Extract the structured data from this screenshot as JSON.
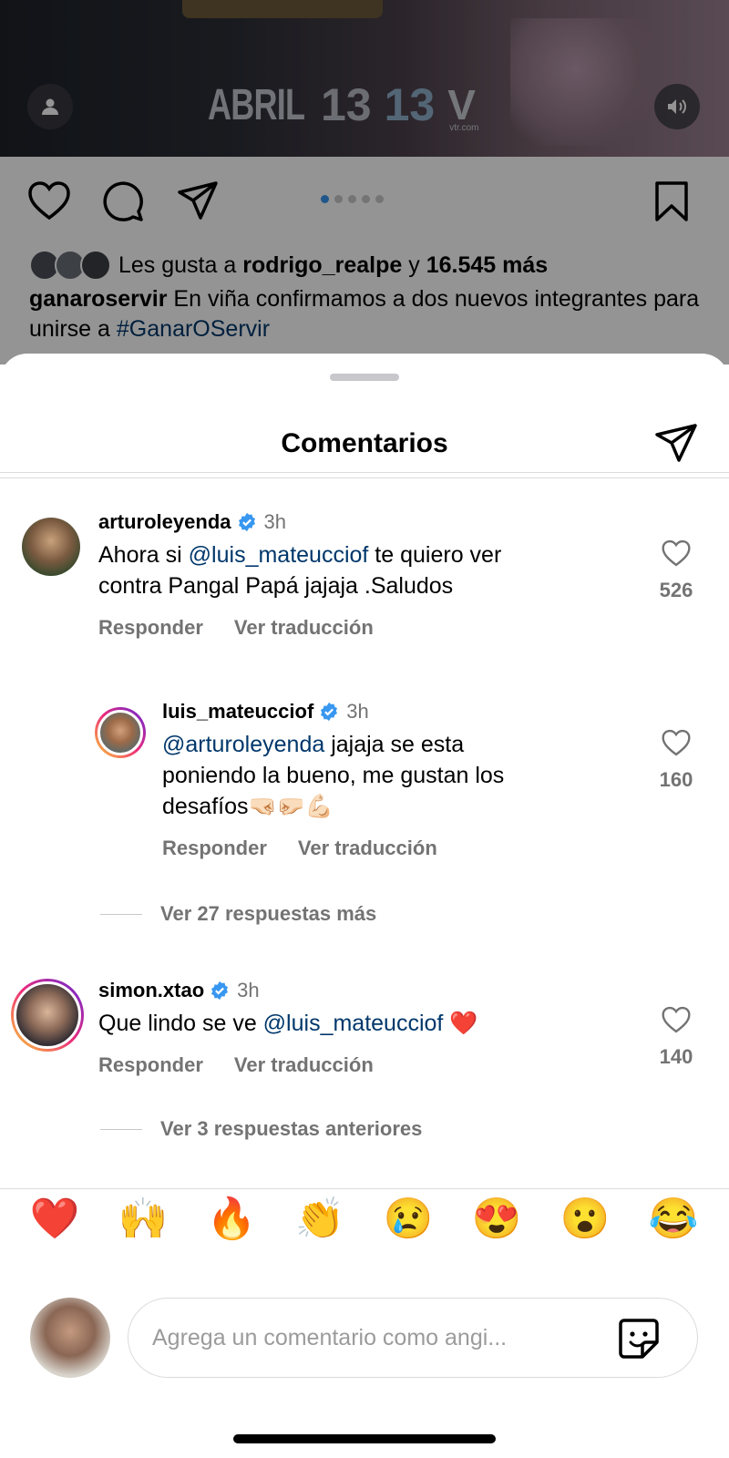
{
  "post": {
    "media_brand": {
      "abril": "ABRIL",
      "n13a": "13",
      "n13b": "13",
      "vtr": "V",
      "vtr_small": "vtr.com"
    },
    "carousel_pages": 5,
    "carousel_active": 1,
    "likes": {
      "prefix": "Les gusta a",
      "user": "rodrigo_realpe",
      "joiner": "y",
      "count": "16.545 más"
    },
    "caption": {
      "user": "ganaroservir",
      "text": "En viña confirmamos a dos nuevos integrantes para unirse a",
      "hashtag": "#GanarOServir"
    }
  },
  "sheet": {
    "title": "Comentarios"
  },
  "comments": [
    {
      "username": "arturoleyenda",
      "time": "3h",
      "mention": "",
      "text_line1_prefix": "Ahora si ",
      "text_line1_mention": "@luis_mateucciof",
      "text_line1_suffix": " te quiero ver",
      "text_line2": "contra Pangal Papá jajaja .Saludos",
      "reply_label": "Responder",
      "translate_label": "Ver traducción",
      "likes": "526"
    },
    {
      "username": "luis_mateucciof",
      "time": "3h",
      "text_line1_mention": "@arturoleyenda",
      "text_line1_suffix": " jajaja se esta",
      "text_line2": "poniendo la bueno, me gustan los",
      "text_line3": "desafíos🤜🏻🤛🏻💪🏻",
      "reply_label": "Responder",
      "translate_label": "Ver traducción",
      "likes": "160"
    },
    {
      "username": "simon.xtao",
      "time": "3h",
      "text_prefix": "Que lindo se ve ",
      "text_mention": "@luis_mateucciof",
      "text_suffix": " ❤️",
      "reply_label": "Responder",
      "translate_label": "Ver traducción",
      "likes": "140"
    }
  ],
  "more_replies_1": "Ver 27 respuestas más",
  "more_replies_2": "Ver 3 respuestas anteriores",
  "emojis": [
    "❤️",
    "🙌",
    "🔥",
    "👏",
    "😢",
    "😍",
    "😮",
    "😂"
  ],
  "composer": {
    "placeholder": "Agrega un comentario como angi..."
  },
  "colors": {
    "link": "#00376b",
    "verified": "#3897f0",
    "muted": "#737373"
  }
}
